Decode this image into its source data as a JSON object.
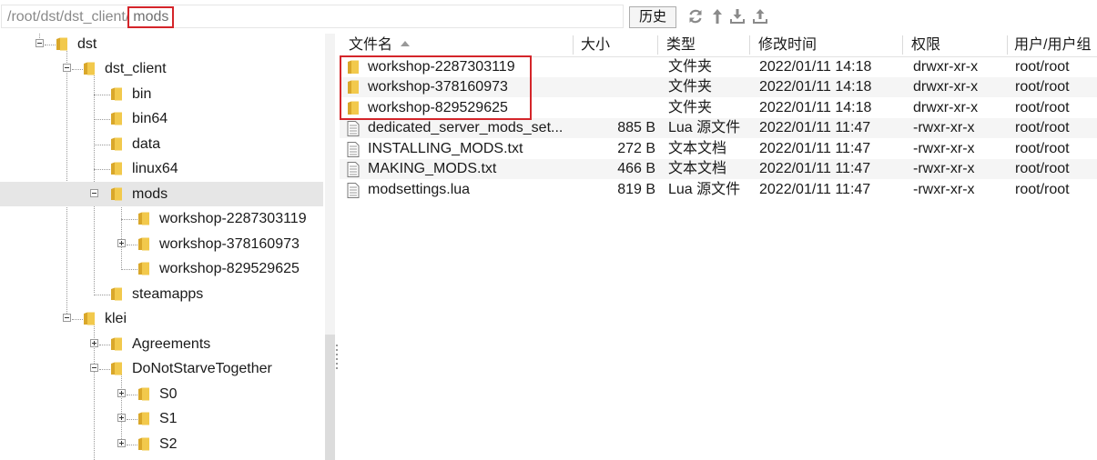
{
  "path_bar": {
    "parent_path": "/root/dst/dst_client/",
    "current_folder": "mods",
    "history_label": "历史"
  },
  "toolbar": {
    "icons": [
      "refresh-icon",
      "go-up-icon",
      "download-icon",
      "upload-icon"
    ]
  },
  "tree": {
    "items": [
      {
        "label": "dst",
        "expanded": true
      },
      {
        "label": "dst_client",
        "expanded": true
      },
      {
        "label": "bin"
      },
      {
        "label": "bin64"
      },
      {
        "label": "data"
      },
      {
        "label": "linux64"
      },
      {
        "label": "mods",
        "expanded": true,
        "selected": true
      },
      {
        "label": "workshop-2287303119"
      },
      {
        "label": "workshop-378160973",
        "collapsed": true
      },
      {
        "label": "workshop-829529625"
      },
      {
        "label": "steamapps"
      },
      {
        "label": "klei",
        "expanded": true
      },
      {
        "label": "Agreements",
        "collapsed": true
      },
      {
        "label": "DoNotStarveTogether",
        "expanded": true
      },
      {
        "label": "S0",
        "collapsed": true
      },
      {
        "label": "S1",
        "collapsed": true
      },
      {
        "label": "S2",
        "collapsed": true
      }
    ]
  },
  "file_list": {
    "columns": {
      "name": "文件名",
      "size": "大小",
      "type": "类型",
      "modified": "修改时间",
      "permissions": "权限",
      "owner": "用户/用户组"
    },
    "rows": [
      {
        "name": "workshop-2287303119",
        "size": "",
        "type": "文件夹",
        "modified": "2022/01/11 14:18",
        "permissions": "drwxr-xr-x",
        "owner": "root/root",
        "kind": "folder"
      },
      {
        "name": "workshop-378160973",
        "size": "",
        "type": "文件夹",
        "modified": "2022/01/11 14:18",
        "permissions": "drwxr-xr-x",
        "owner": "root/root",
        "kind": "folder"
      },
      {
        "name": "workshop-829529625",
        "size": "",
        "type": "文件夹",
        "modified": "2022/01/11 14:18",
        "permissions": "drwxr-xr-x",
        "owner": "root/root",
        "kind": "folder"
      },
      {
        "name": "dedicated_server_mods_set...",
        "size": "885 B",
        "type": "Lua 源文件",
        "modified": "2022/01/11 11:47",
        "permissions": "-rwxr-xr-x",
        "owner": "root/root",
        "kind": "file"
      },
      {
        "name": "INSTALLING_MODS.txt",
        "size": "272 B",
        "type": "文本文档",
        "modified": "2022/01/11 11:47",
        "permissions": "-rwxr-xr-x",
        "owner": "root/root",
        "kind": "file"
      },
      {
        "name": "MAKING_MODS.txt",
        "size": "466 B",
        "type": "文本文档",
        "modified": "2022/01/11 11:47",
        "permissions": "-rwxr-xr-x",
        "owner": "root/root",
        "kind": "file"
      },
      {
        "name": "modsettings.lua",
        "size": "819 B",
        "type": "Lua 源文件",
        "modified": "2022/01/11 11:47",
        "permissions": "-rwxr-xr-x",
        "owner": "root/root",
        "kind": "file"
      }
    ]
  },
  "colors": {
    "highlight_box": "#d4252a",
    "folder_yellow": "#f2c94c",
    "selected_row": "#e6e6e6",
    "alt_row": "#f5f5f5"
  }
}
